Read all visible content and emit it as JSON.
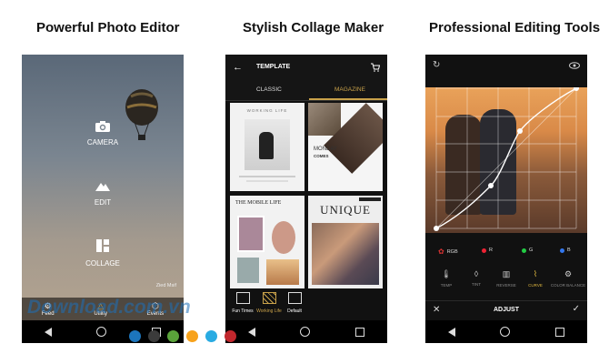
{
  "captions": {
    "photo_editor": "Powerful Photo Editor",
    "collage_maker": "Stylish Collage Maker",
    "editing_tools": "Professional Editing Tools"
  },
  "phone1": {
    "menu": {
      "camera": "CAMERA",
      "edit": "EDIT",
      "collage": "COLLAGE"
    },
    "photo_credit": "Zied Msif",
    "tabs": {
      "feed": "Feed",
      "utility": "Utility",
      "events": "Events"
    }
  },
  "phone2": {
    "header_title": "TEMPLATE",
    "tabs": {
      "classic": "CLASSIC",
      "magazine": "MAGAZINE"
    },
    "cards": {
      "working_life": "WORKING LIFE",
      "monday": "MONDAY",
      "comes": "COMES",
      "mobile_life": "THE MOBILE LIFE",
      "unique": "UNIQUE"
    },
    "bottom_tabs": {
      "fun_times": "Fun Times",
      "working_life": "Working Life",
      "default": "Default"
    }
  },
  "phone3": {
    "channels": {
      "rgb": "RGB",
      "r": "R",
      "g": "G",
      "b": "B"
    },
    "tools": {
      "temp": "TEMP",
      "tint": "TINT",
      "reverse": "REVERSE",
      "curve": "CURVE",
      "color_balance": "COLOR BALANCE"
    },
    "bottom_title": "ADJUST"
  },
  "watermark": "Download.com.vn",
  "colors": {
    "accent_gold": "#c9a24a",
    "curve_active": "#e0b840",
    "watermark_blue": "#1e6fb8",
    "dots": [
      "#1c75bc",
      "#3b3b3b",
      "#5aa33a",
      "#f7a21b",
      "#29abe2",
      "#c1272d"
    ]
  }
}
